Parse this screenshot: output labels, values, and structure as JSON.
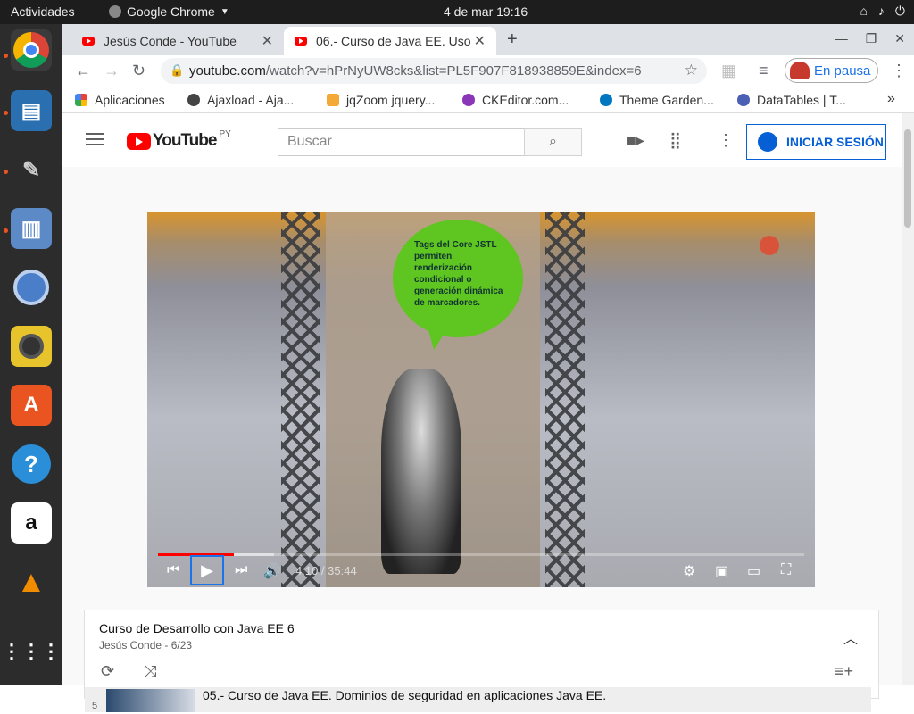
{
  "system": {
    "activities": "Actividades",
    "app_name": "Google Chrome",
    "clock": "4 de mar  19:16"
  },
  "browser": {
    "tabs": [
      {
        "title": "Jesús Conde - YouTube"
      },
      {
        "title": "06.- Curso de Java EE. Uso"
      }
    ],
    "url_host": "youtube.com",
    "url_path": "/watch?v=hPrNyUW8cks&list=PL5F907F818938859E&index=6",
    "profile_status": "En pausa",
    "bookmarks": [
      {
        "label": "Aplicaciones"
      },
      {
        "label": "Ajaxload - Aja..."
      },
      {
        "label": "jqZoom jquery..."
      },
      {
        "label": "CKEditor.com..."
      },
      {
        "label": "Theme Garden..."
      },
      {
        "label": "DataTables | T..."
      }
    ]
  },
  "youtube": {
    "logo_text": "YouTube",
    "region": "PY",
    "search_placeholder": "Buscar",
    "login_label": "INICIAR SESIÓN"
  },
  "player": {
    "overlay_text": "Tags del Core JSTL permiten renderización condicional o generación dinámica de marcadores.",
    "time": "4:10 / 35:44",
    "played_fraction": 0.117,
    "buffered_fraction": 0.18
  },
  "playlist": {
    "title": "Curso de Desarrollo con Java EE 6",
    "subtitle": "Jesús Conde - 6/23",
    "item_title": "05.- Curso de Java EE. Dominios de seguridad en aplicaciones Java EE.",
    "item_index": "5"
  },
  "colors": {
    "accent": "#065fd4",
    "youtube_red": "#ff0000",
    "ubuntu_orange": "#e95420"
  }
}
